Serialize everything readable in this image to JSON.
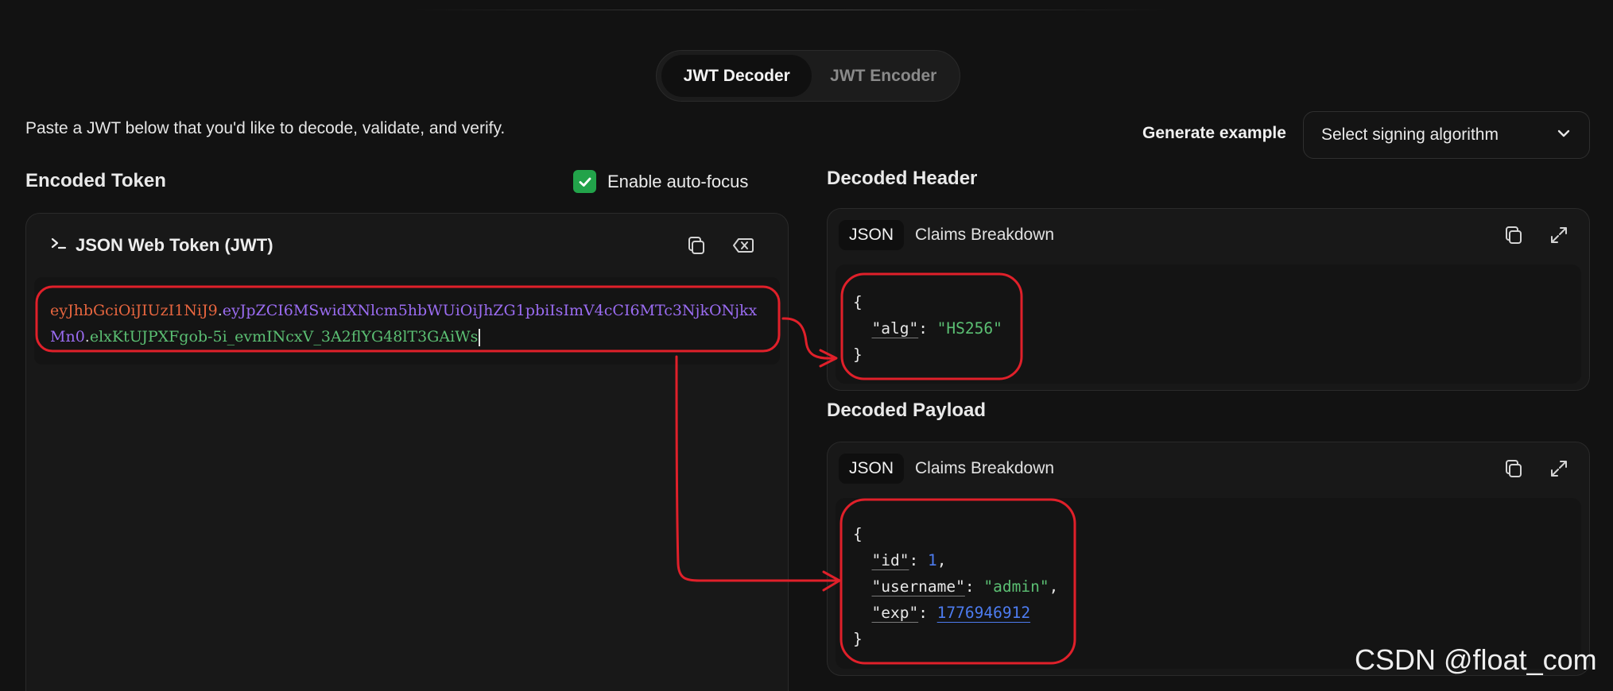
{
  "mode": {
    "decoder_label": "JWT Decoder",
    "encoder_label": "JWT Encoder"
  },
  "intro": "Paste a JWT below that you'd like to decode, validate, and verify.",
  "generate": {
    "label": "Generate example",
    "select_value": "Select signing algorithm"
  },
  "encoded": {
    "title": "Encoded Token",
    "autofocus_label": "Enable auto-focus",
    "autofocus_checked": true,
    "panel_title": "JSON Web Token (JWT)",
    "token_header": "eyJhbGciOiJIUzI1NiJ9",
    "token_payload": "eyJpZCI6MSwidXNlcm5hbWUiOiJhZG1pbiIsImV4cCI6MTc3NjkONjkxMn0",
    "token_signature": "elxKtUJPXFgob-5i_evmINcxV_3A2flYG48lT3GAiWs",
    "dot": "."
  },
  "decoded_header": {
    "title": "Decoded Header",
    "tab_json": "JSON",
    "tab_claims": "Claims Breakdown",
    "open": "{",
    "close": "}",
    "alg_key": "\"alg\"",
    "alg_value": "\"HS256\""
  },
  "decoded_payload": {
    "title": "Decoded Payload",
    "tab_json": "JSON",
    "tab_claims": "Claims Breakdown",
    "open": "{",
    "close": "}",
    "id_key": "\"id\"",
    "id_value": "1",
    "username_key": "\"username\"",
    "username_value": "\"admin\"",
    "exp_key": "\"exp\"",
    "exp_value": "1776946912"
  },
  "punct": {
    "colon": ": ",
    "comma": ","
  },
  "watermark": "CSDN @float_com",
  "colors": {
    "accent_check": "#22a34a",
    "annotation": "#e0202a",
    "token_header": "#e8663f",
    "token_payload": "#9b6cf2",
    "token_signature": "#5bbf73"
  }
}
